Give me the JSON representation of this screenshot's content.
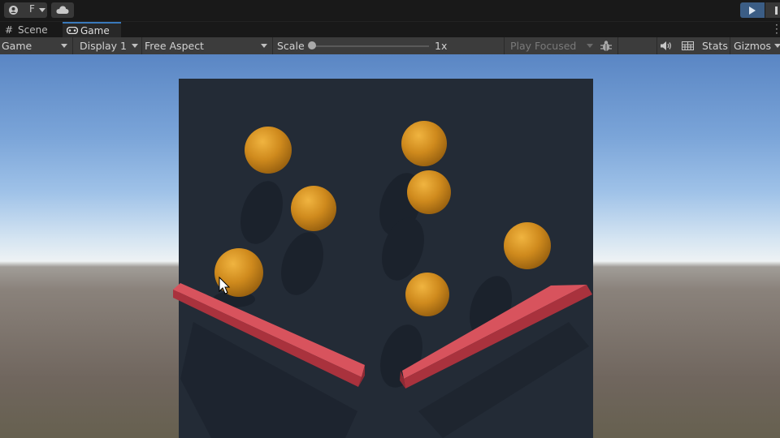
{
  "top_bar": {
    "account_label": "F",
    "icons": [
      "user-icon",
      "cloud-icon",
      "play-icon",
      "pause-icon"
    ]
  },
  "tabs": [
    {
      "label": "Scene",
      "icon": "hash-icon",
      "active": false
    },
    {
      "label": "Game",
      "icon": "gamepad-icon",
      "active": true
    }
  ],
  "game_toolbar": {
    "view_mode": "Game",
    "display": "Display 1",
    "aspect": "Free Aspect",
    "scale_label": "Scale",
    "scale_value": "1x",
    "play_mode": "Play Focused",
    "stats_label": "Stats",
    "gizmos_label": "Gizmos",
    "icons": [
      "bug-icon",
      "speaker-icon",
      "keyboard-icon"
    ]
  },
  "scene": {
    "board_color": "#232b36",
    "ball_color": "#d4921c",
    "paddle_color": "#c8404a",
    "ball_count": 7
  }
}
